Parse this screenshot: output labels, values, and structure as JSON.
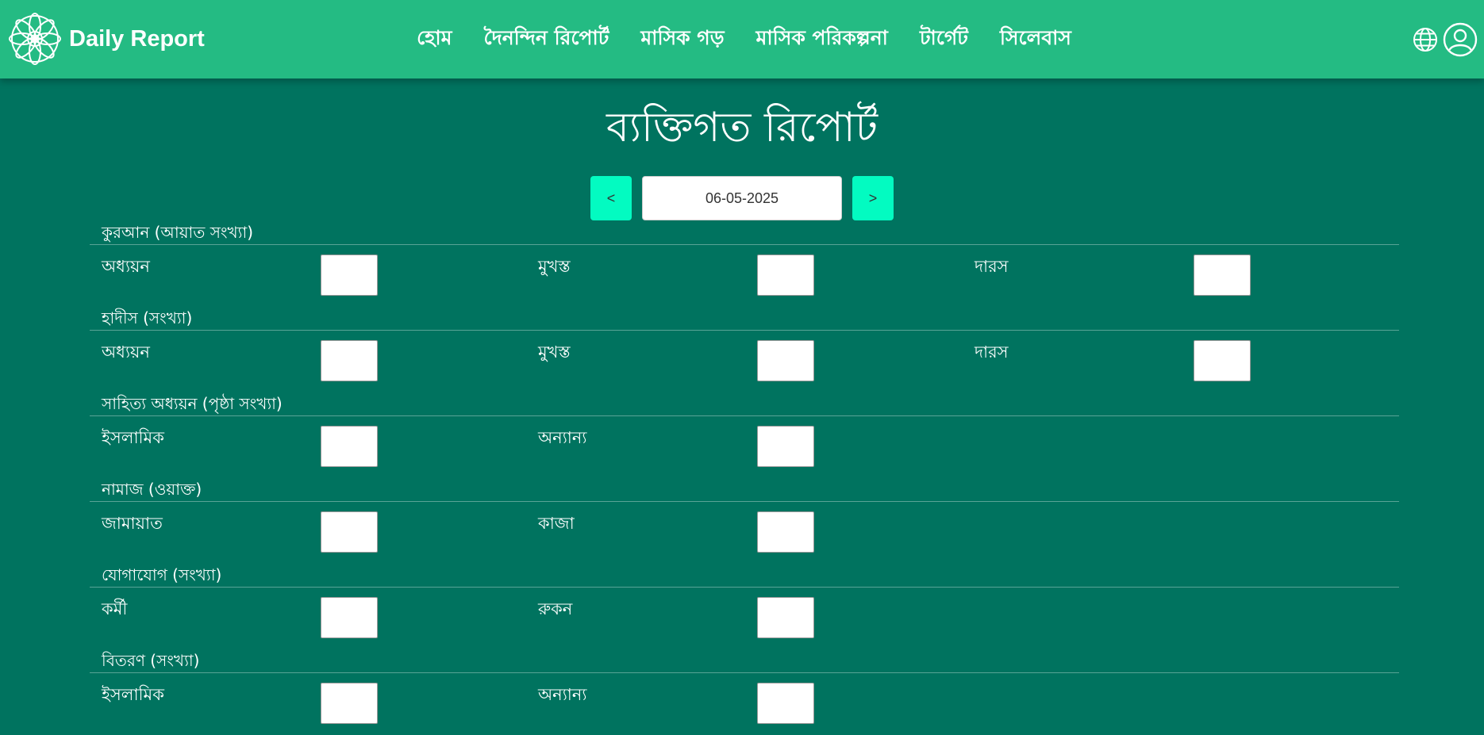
{
  "brand": {
    "name": "Daily Report",
    "logo_icon": "ornamental-flower-icon"
  },
  "nav": {
    "links": [
      "হোম",
      "দৈনন্দিন রিপোর্ট",
      "মাসিক গড়",
      "মাসিক পরিকল্পনা",
      "টার্গেট",
      "সিলেবাস"
    ],
    "right_icons": [
      "globe-icon",
      "user-icon"
    ]
  },
  "page": {
    "title": "ব্যক্তিগত রিপোর্ট",
    "date_value": "06-05-2025",
    "prev_label": "<",
    "next_label": ">"
  },
  "sections": [
    {
      "title": "কুরআন (আয়াত সংখ্যা)",
      "fields": [
        "অধ্যয়ন",
        "মুখস্ত",
        "দারস"
      ]
    },
    {
      "title": "হাদীস (সংখ্যা)",
      "fields": [
        "অধ্যয়ন",
        "মুখস্ত",
        "দারস"
      ]
    },
    {
      "title": "সাহিত্য অধ্যয়ন (পৃষ্ঠা সংখ্যা)",
      "fields": [
        "ইসলামিক",
        "অন্যান্য"
      ]
    },
    {
      "title": "নামাজ (ওয়াক্ত)",
      "fields": [
        "জামায়াত",
        "কাজা"
      ]
    },
    {
      "title": "যোগাযোগ (সংখ্যা)",
      "fields": [
        "কর্মী",
        "রুকন"
      ]
    },
    {
      "title": "বিতরণ (সংখ্যা)",
      "fields": [
        "ইসলামিক",
        "অন্যান্য"
      ]
    }
  ],
  "colors": {
    "navbar": "#24bb83",
    "page_background": "#00735f",
    "arrow_button": "#03fbc1"
  }
}
